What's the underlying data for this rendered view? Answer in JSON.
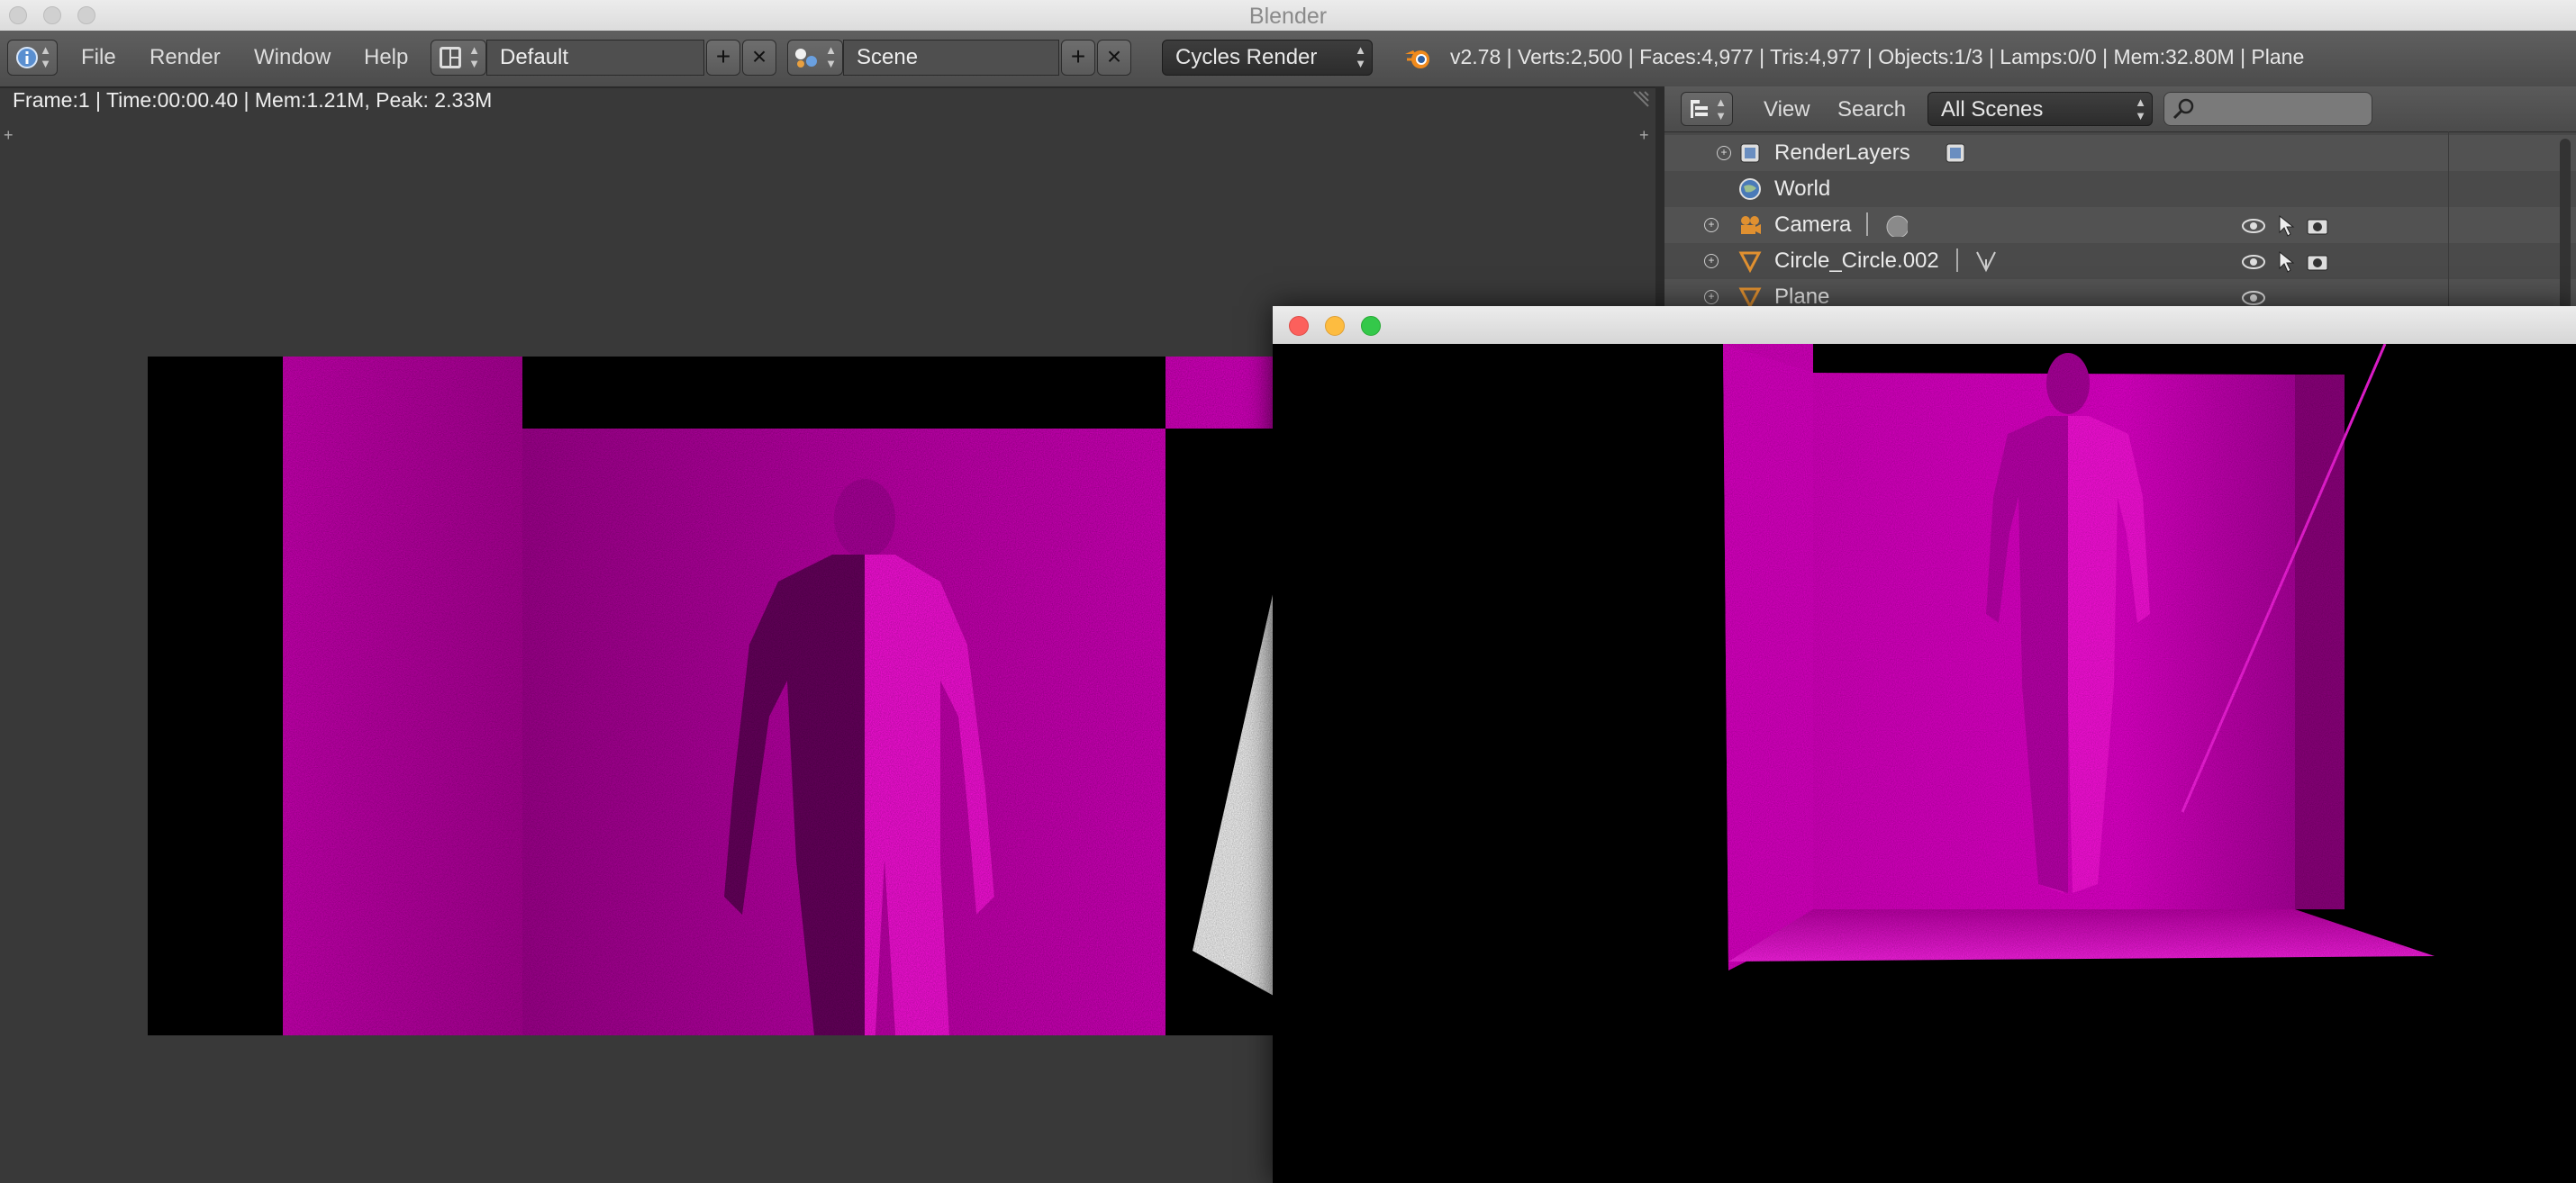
{
  "window": {
    "title": "Blender"
  },
  "menu": {
    "file": "File",
    "render": "Render",
    "window": "Window",
    "help": "Help"
  },
  "layout": {
    "value": "Default",
    "add": "+",
    "close": "×"
  },
  "scene": {
    "value": "Scene",
    "add": "+",
    "close": "×"
  },
  "engine": {
    "value": "Cycles Render"
  },
  "stats": "v2.78 | Verts:2,500 | Faces:4,977 | Tris:4,977 | Objects:1/3 | Lamps:0/0 | Mem:32.80M | Plane",
  "render_info": "Frame:1 | Time:00:00.40 | Mem:1.21M, Peak: 2.33M",
  "outliner": {
    "view_label": "View",
    "search_label": "Search",
    "scenes_select": "All Scenes",
    "search_placeholder": "",
    "rows": [
      {
        "label": "RenderLayers"
      },
      {
        "label": "World"
      },
      {
        "label": "Camera"
      },
      {
        "label": "Circle_Circle.002"
      },
      {
        "label": "Plane"
      }
    ]
  },
  "colors": {
    "magenta": "#e000c8",
    "header": "#505050",
    "editor_bg": "#393939"
  },
  "icons": [
    "info-icon",
    "screen-layout-icon",
    "scene-icon",
    "blender-logo-icon",
    "outliner-icon",
    "search-icon",
    "renderlayers-icon",
    "world-icon",
    "camera-icon",
    "mesh-icon",
    "eye-icon",
    "cursor-icon",
    "render-camera-icon"
  ]
}
